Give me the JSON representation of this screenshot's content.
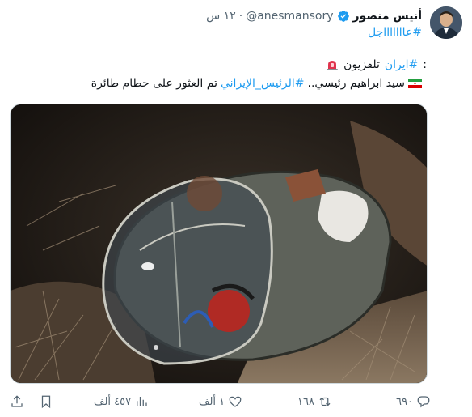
{
  "author": {
    "name": "أنيس منصور",
    "handle": "@anesmansory",
    "separator": "·",
    "time": "١٢ س"
  },
  "tweet": {
    "hashtag_top": "#عاااااااجل",
    "line1_prefix": "تلفزيون",
    "line1_hashtag": "#ايران",
    "line1_suffix": ":",
    "line2_prefix": "تم العثور على حطام طائرة",
    "line2_hashtag": "#الرئيس_الإيراني",
    "line2_suffix": "سيد ابراهيم رئيسي.."
  },
  "icons": {
    "verified": "verified-badge-icon",
    "siren": "rotating-light-emoji",
    "flag": "iran-flag-emoji"
  },
  "actions": {
    "views": "٤٥٧ ألف",
    "likes": "١ ألف",
    "retweets": "١٦٨",
    "replies": "٦٩٠"
  },
  "colors": {
    "accent": "#1d9bf0",
    "muted": "#536471",
    "text": "#0f1419"
  }
}
